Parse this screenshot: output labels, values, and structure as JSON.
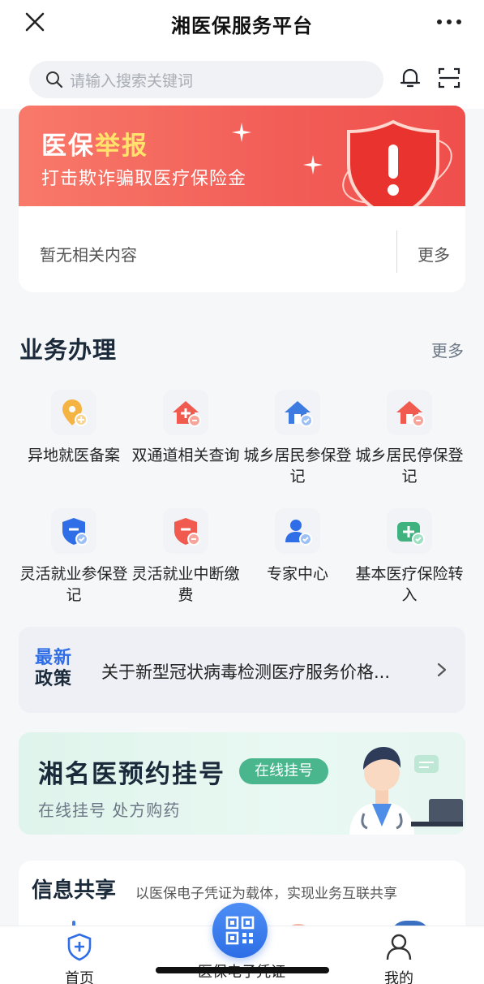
{
  "header": {
    "title": "湘医保服务平台",
    "close_icon": "close-icon",
    "more_icon": "more-dots-icon"
  },
  "search": {
    "placeholder": "请输入搜索关键词",
    "notification_icon": "bell-icon",
    "scan_icon": "scan-icon"
  },
  "banner": {
    "title_part1": "医保",
    "title_part2": "举报",
    "subtitle": "打击欺诈骗取医疗保险金",
    "accent": "#f25f58",
    "highlight": "#ffe36b"
  },
  "notice": {
    "empty_text": "暂无相关内容",
    "more_label": "更多"
  },
  "business": {
    "heading": "业务办理",
    "more_label": "更多",
    "items": [
      {
        "label": "异地就医备案",
        "icon": "location-plus-icon"
      },
      {
        "label": "双通道相关查询",
        "icon": "house-plus-icon"
      },
      {
        "label": "城乡居民参保登记",
        "icon": "house-check-icon"
      },
      {
        "label": "城乡居民停保登记",
        "icon": "house-minus-icon"
      },
      {
        "label": "灵活就业参保登记",
        "icon": "shield-check-icon"
      },
      {
        "label": "灵活就业中断缴费",
        "icon": "shield-minus-icon"
      },
      {
        "label": "专家中心",
        "icon": "person-check-icon"
      },
      {
        "label": "基本医疗保险转入",
        "icon": "medkit-check-icon"
      }
    ]
  },
  "policy": {
    "tag_line1": "最新",
    "tag_line2": "政策",
    "text": "关于新型冠状病毒检测医疗服务价格...",
    "chevron_icon": "chevron-right-icon"
  },
  "appointment": {
    "title": "湘名医预约挂号",
    "pill": "在线挂号",
    "subtitle": "在线挂号 处方购药",
    "pill_color": "#49b68d"
  },
  "share": {
    "heading": "信息共享",
    "subtitle": "以医保电子凭证为载体，实现业务互联共享"
  },
  "tabbar": {
    "home": "首页",
    "center": "医保电子凭证",
    "mine": "我的",
    "active_color": "#2f6ee6"
  }
}
